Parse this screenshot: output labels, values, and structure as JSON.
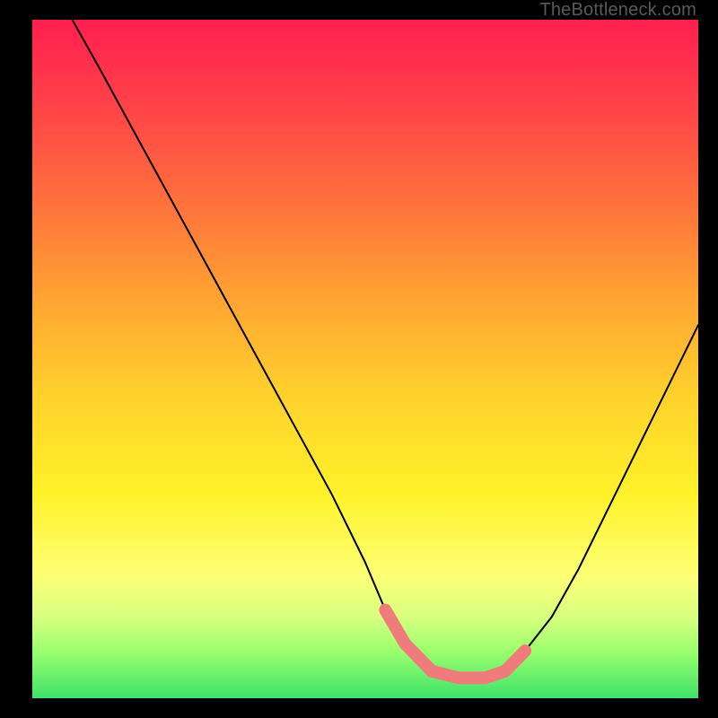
{
  "watermark": "TheBottleneck.com",
  "chart_data": {
    "type": "line",
    "title": "",
    "xlabel": "",
    "ylabel": "",
    "xlim": [
      0,
      100
    ],
    "ylim": [
      0,
      100
    ],
    "series": [
      {
        "name": "black-curve",
        "x": [
          6,
          10,
          15,
          20,
          25,
          30,
          35,
          40,
          45,
          50,
          53,
          56,
          60,
          64,
          68,
          71,
          74,
          78,
          82,
          86,
          90,
          95,
          100
        ],
        "y": [
          100,
          93,
          84,
          75,
          66,
          57,
          48,
          39,
          30,
          20,
          13,
          8,
          4,
          3,
          3,
          4,
          7,
          12,
          19,
          27,
          35,
          45,
          55
        ]
      },
      {
        "name": "pink-flat-trough",
        "x": [
          53,
          56,
          60,
          64,
          68,
          71,
          74
        ],
        "y": [
          13,
          8,
          4,
          3,
          3,
          4,
          7
        ]
      }
    ],
    "colors": {
      "curve": "#000000",
      "trough": "#ef7b7b",
      "gradient_top": "#ff1f4f",
      "gradient_mid": "#fff22a",
      "gradient_bottom": "#3fe26a"
    }
  }
}
